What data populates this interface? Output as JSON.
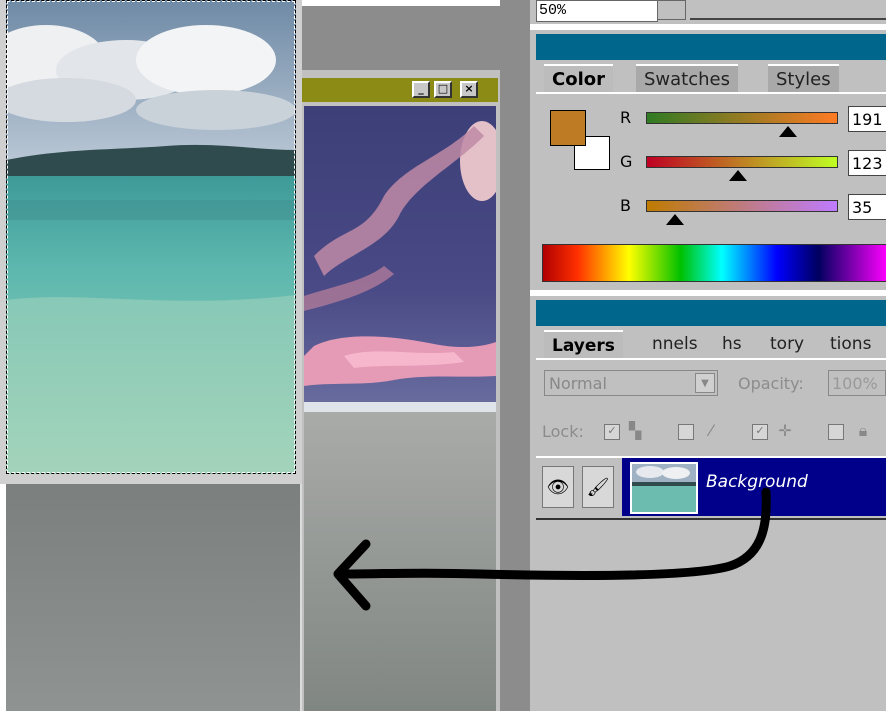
{
  "color_palette": {
    "tabs": [
      "Color",
      "Swatches",
      "Styles"
    ],
    "active_tab": "Color",
    "foreground_color": "#bf7b23",
    "background_color": "#ffffff",
    "channels": [
      {
        "label": "R",
        "value": "191"
      },
      {
        "label": "G",
        "value": "123"
      },
      {
        "label": "B",
        "value": "35"
      }
    ]
  },
  "navigator": {
    "zoom_value": "50%"
  },
  "layers_palette": {
    "tabs": [
      "Layers",
      "nnels",
      "hs",
      "tory",
      "tions"
    ],
    "active_tab": "Layers",
    "blend_mode": "Normal",
    "opacity_label": "Opacity:",
    "opacity_value": "100%",
    "lock_label": "Lock:",
    "layers": [
      {
        "name": "Background",
        "visible": true,
        "selected": true
      }
    ]
  },
  "annotation": {
    "arrow_color": "#000000",
    "arrow_direction": "from layer to canvas"
  },
  "icons": {
    "eye": "eye-icon",
    "brush": "brush-icon",
    "minimize": "minimize-icon",
    "maximize": "maximize-icon",
    "close": "close-icon"
  },
  "window_buttons": {
    "minimize": "_",
    "maximize": "□",
    "close": "×"
  }
}
